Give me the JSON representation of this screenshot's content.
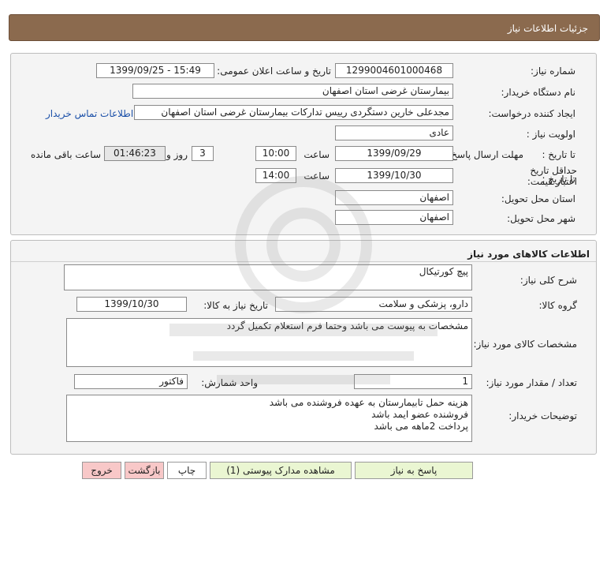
{
  "header": {
    "title": "جزئیات اطلاعات نیاز"
  },
  "form": {
    "need_number_label": "شماره نیاز:",
    "need_number": "1299004601000468",
    "announce_label": "تاریخ و ساعت اعلان عمومی:",
    "announce_value": "1399/09/25 - 15:49",
    "buyer_org_label": "نام دستگاه خریدار:",
    "buyer_org": "بیمارستان غرضی استان اصفهان",
    "creator_label": "ایجاد کننده درخواست:",
    "creator": "مجدعلی خارین دستگردی رییس تدارکات بیمارستان غرضی استان اصفهان",
    "contact_link": "اطلاعات تماس خریدار",
    "priority_label": "اولویت نیاز :",
    "priority": "عادی",
    "reply_deadline_label": "مهلت ارسال پاسخ:",
    "to_date_label": "تا تاریخ :",
    "reply_date": "1399/09/29",
    "time_label": "ساعت",
    "reply_time": "10:00",
    "days_value": "3",
    "days_label": "روز و",
    "remaining_time": "01:46:23",
    "remaining_label": "ساعت باقی مانده",
    "validity_label": "حداقل تاریخ اعتبار قیمت:",
    "validity_to_label": "تا تاریخ :",
    "validity_date": "1399/10/30",
    "validity_time_label": "ساعت",
    "validity_time": "14:00",
    "province_label": "استان محل تحویل:",
    "province": "اصفهان",
    "city_label": "شهر محل تحویل:",
    "city": "اصفهان"
  },
  "goods": {
    "section_title": "اطلاعات کالاهای مورد نیاز",
    "summary_label": "شرح کلی نیاز:",
    "summary": "پیچ کورتیکال",
    "group_label": "گروه کالا:",
    "group": "دارو، پزشکی و سلامت",
    "need_date_label": "تاریخ نیاز به کالا:",
    "need_date": "1399/10/30",
    "spec_label": "مشخصات کالای مورد نیاز:",
    "spec": "مشخصات به پیوست می باشد وحتما فرم استعلام تکمیل گردد",
    "qty_label": "تعداد / مقدار مورد نیاز:",
    "qty": "1",
    "unit_label": "واحد شمارش:",
    "unit": "فاکتور",
    "notes_label": "توضیحات خریدار:",
    "notes": "هزینه حمل تابیمارستان به عهده فروشنده می باشد\nفروشنده عضو ایمد باشد\nپرداخت 2ماهه می باشد"
  },
  "buttons": {
    "reply": "پاسخ به نیاز",
    "attachments": "مشاهده مدارک پیوستی (1)",
    "print": "چاپ",
    "back": "بازگشت",
    "exit": "خروج"
  },
  "colors": {
    "header_bg": "#8b6a4e",
    "panel_bg": "#f4f4f4",
    "button_green": "#eaf6d2",
    "button_red": "#f8c8c8",
    "link_blue": "#1a4fa8"
  }
}
